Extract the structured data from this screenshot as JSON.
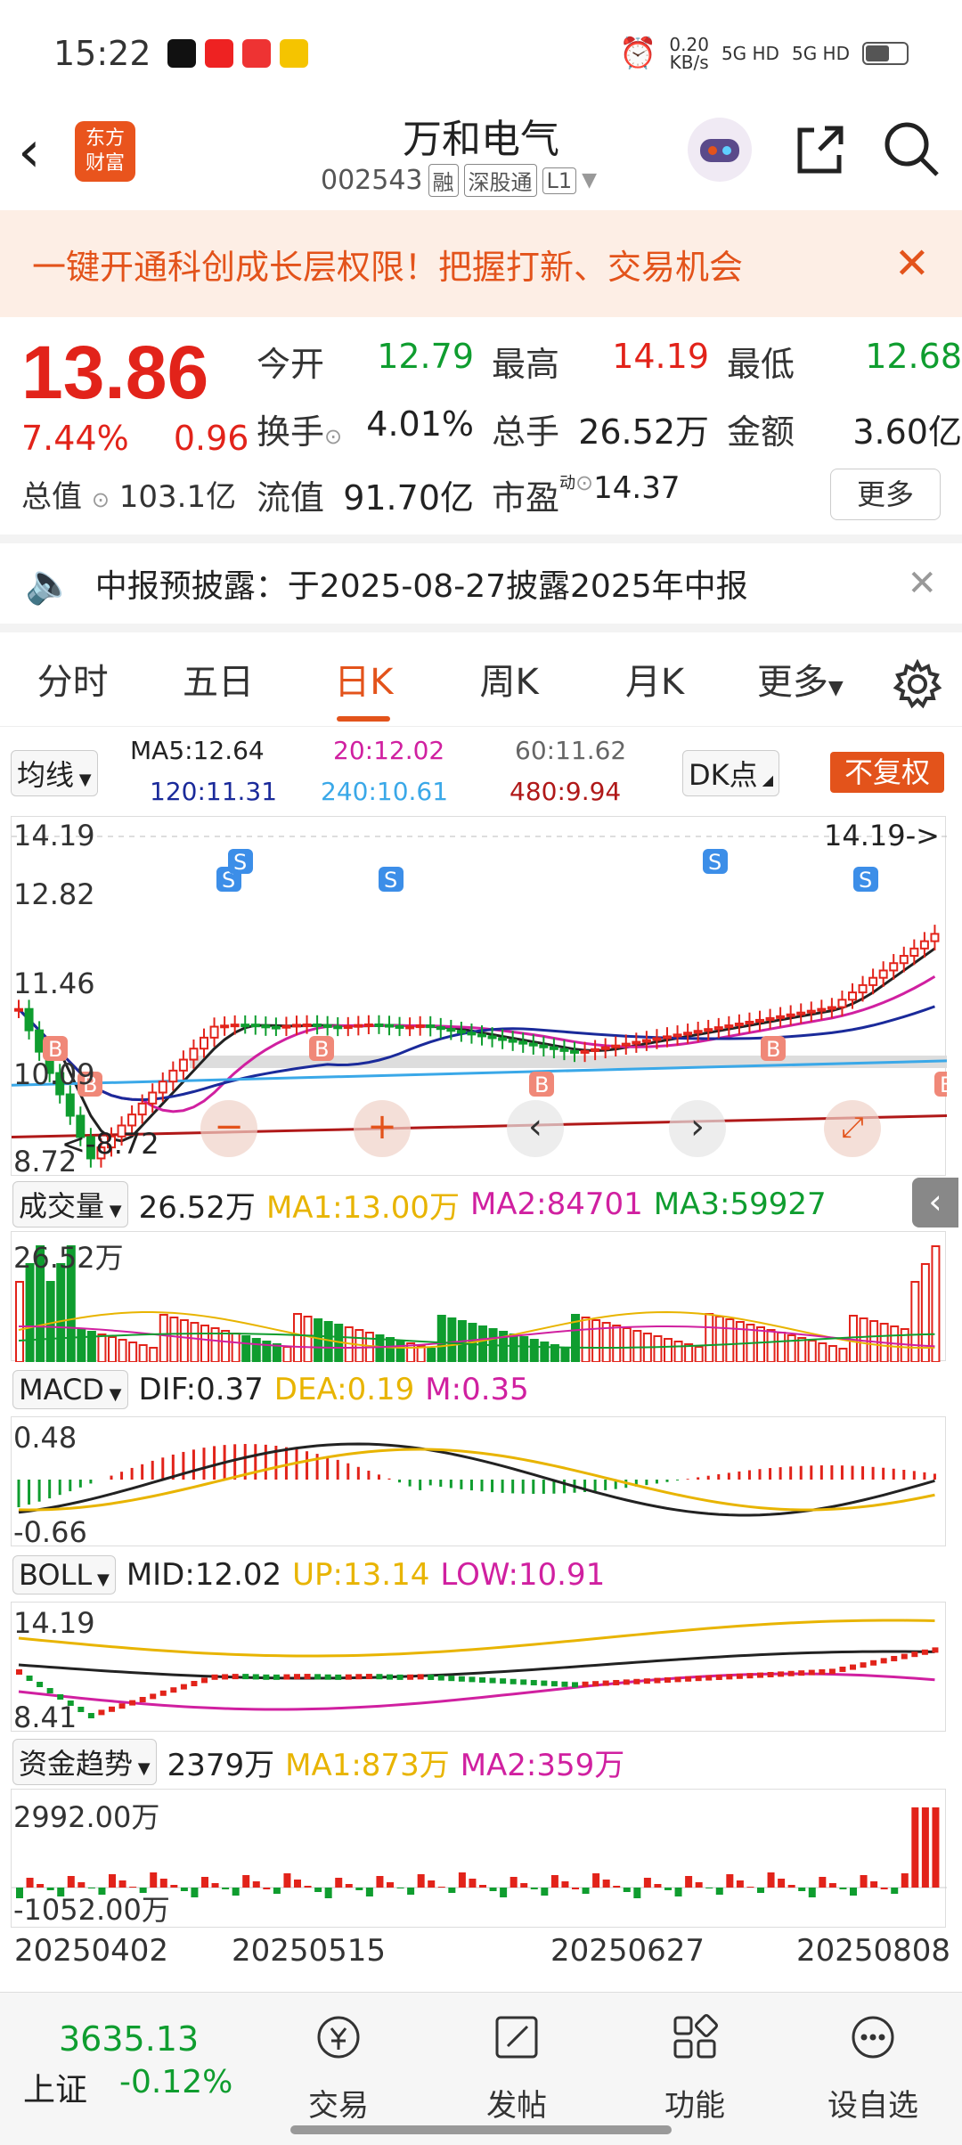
{
  "status": {
    "time": "15:22",
    "net_speed": "0.20",
    "net_unit": "KB/s",
    "sig1": "5G HD",
    "sig2": "5G HD"
  },
  "header": {
    "logo_line1": "东方",
    "logo_line2": "财富",
    "title": "万和电气",
    "code": "002543",
    "tags": [
      "融",
      "深股通",
      "L1"
    ]
  },
  "promo": {
    "text": "一键开通科创成长层权限！把握打新、交易机会"
  },
  "quote": {
    "price": "13.86",
    "pct": "7.44%",
    "chg": "0.96",
    "open_label": "今开",
    "open": "12.79",
    "high_label": "最高",
    "high": "14.19",
    "low_label": "最低",
    "low": "12.68",
    "turnover_label": "换手",
    "turnover": "4.01%",
    "vol_label": "总手",
    "vol": "26.52万",
    "amount_label": "金额",
    "amount": "3.60亿",
    "mcap_label": "总值",
    "mcap": "103.1亿",
    "float_label": "流值",
    "float": "91.70亿",
    "pe_label": "市盈",
    "pe_sup": "动",
    "pe": "14.37",
    "more": "更多"
  },
  "notice": {
    "text": "中报预披露：于2025-08-27披露2025年中报"
  },
  "tabs": [
    "分时",
    "五日",
    "日K",
    "周K",
    "月K",
    "更多"
  ],
  "ma": {
    "selector": "均线",
    "ma5": "MA5:12.64",
    "ma20": "20:12.02",
    "ma60": "60:11.62",
    "ma120": "120:11.31",
    "ma240": "240:10.61",
    "ma480": "480:9.94",
    "dk": "DK点",
    "fq": "不复权",
    "y_top": "14.19",
    "y_mid1": "12.82",
    "y_mid2": "11.46",
    "y_mid3": "10.09",
    "y_bot": "8.72",
    "max_flag": "14.19->",
    "min_flag": "<-8.72"
  },
  "volume": {
    "selector": "成交量",
    "value": "26.52万",
    "ma1": "MA1:13.00万",
    "ma2": "MA2:84701",
    "ma3": "MA3:59927",
    "y_top": "26.52万"
  },
  "macd": {
    "selector": "MACD",
    "dif": "DIF:0.37",
    "dea": "DEA:0.19",
    "m": "M:0.35",
    "y_top": "0.48",
    "y_bot": "-0.66"
  },
  "boll": {
    "selector": "BOLL",
    "mid": "MID:12.02",
    "up": "UP:13.14",
    "low": "LOW:10.91",
    "y_top": "14.19",
    "y_bot": "8.41"
  },
  "fund": {
    "selector": "资金趋势",
    "value": "2379万",
    "ma1": "MA1:873万",
    "ma2": "MA2:359万",
    "y_top": "2992.00万",
    "y_bot": "-1052.00万"
  },
  "dates": [
    "20250402",
    "20250515",
    "20250627",
    "20250808"
  ],
  "bottom": {
    "index_value": "3635.13",
    "index_name": "上证",
    "index_chg": "-0.12%",
    "items": [
      "交易",
      "发帖",
      "功能",
      "设自选"
    ]
  },
  "colors": {
    "up": "#e2231a",
    "down": "#0f9d2f",
    "accent": "#e3531b",
    "ma5": "#222222",
    "ma20": "#d020a0",
    "ma60": "#888888",
    "ma120": "#1a2a9a",
    "ma240": "#3aa8e8",
    "ma480": "#b01818"
  }
}
